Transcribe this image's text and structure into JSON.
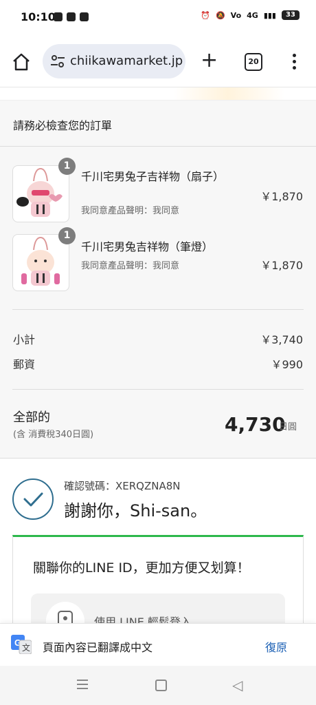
{
  "status_bar": {
    "time": "10:10",
    "network": "4G",
    "battery": "33"
  },
  "browser": {
    "url": "chiikawamarket.jp",
    "tab_count": "20"
  },
  "order": {
    "heading": "請務必檢查您的訂單",
    "items": [
      {
        "name": "千川宅男兔子吉祥物（扇子）",
        "note": "我同意產品聲明：我同意",
        "price": "￥1,870",
        "qty": "1"
      },
      {
        "name": "千川宅男兔吉祥物（筆燈）",
        "note": "我同意產品聲明：我同意",
        "price": "￥1,870",
        "qty": "1"
      }
    ],
    "subtotal_label": "小計",
    "subtotal_value": "￥3,740",
    "shipping_label": "郵資",
    "shipping_value": "￥990",
    "total_label": "全部的",
    "tax_note": "(含 消費稅340日圓)",
    "total_value": "4,730",
    "total_unit": "日圓"
  },
  "confirmation": {
    "number_text": "確認號碼：XERQZNA8N",
    "thanks_text": "謝謝你，Shi-san。"
  },
  "line_card": {
    "title": "關聯你的LINE ID，更加方便又划算！",
    "login_text": "使用 LINE 輕鬆登入"
  },
  "translate_bar": {
    "text": "頁面內容已翻譯成中文",
    "restore_label": "復原"
  },
  "colors": {
    "accent_green": "#2db84c",
    "confirm_blue": "#2f6e8f",
    "link_blue": "#1a5fb4"
  }
}
